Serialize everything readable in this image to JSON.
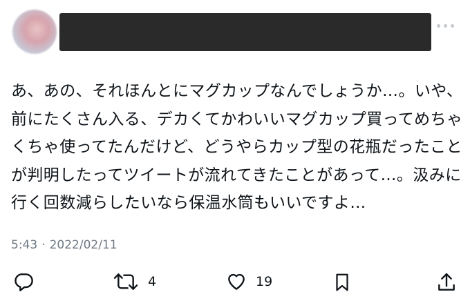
{
  "tweet": {
    "lines": [
      "あ、あの、それほんとにマグカップなんでしょうか…。いや、",
      "前にたくさん入る、デカくてかわいいマグカップ買ってめちゃ",
      "くちゃ使ってたんだけど、どうやらカップ型の花瓶だったこと",
      "が判明したってツイートが流れてきたことがあって…。汲みに",
      "行く回数減らしたいなら保温水筒もいいですよ…"
    ],
    "time": "5:43",
    "separator": "·",
    "date": "2022/02/11"
  },
  "actions": {
    "reply_icon": "reply-icon",
    "retweet_icon": "retweet-icon",
    "retweet_count": "4",
    "like_icon": "heart-icon",
    "like_count": "19",
    "bookmark_icon": "bookmark-icon",
    "share_icon": "share-icon"
  }
}
